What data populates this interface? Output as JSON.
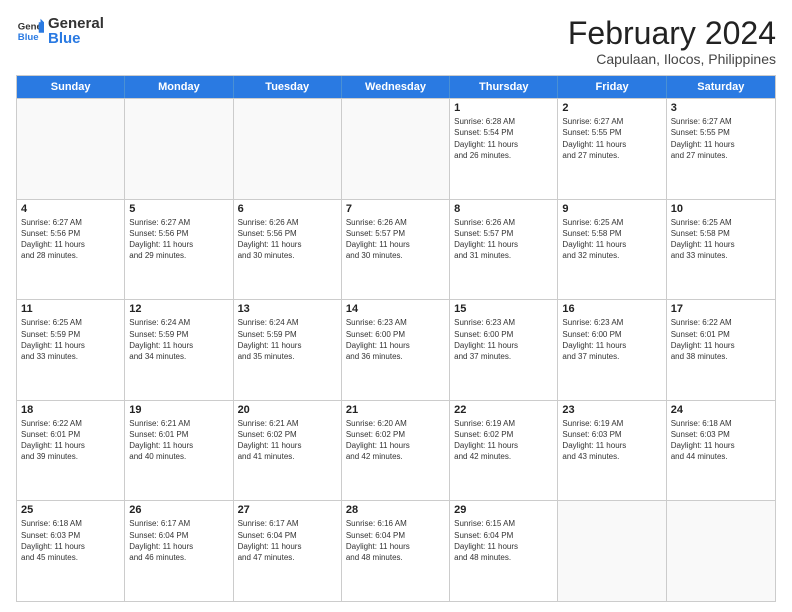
{
  "logo": {
    "general": "General",
    "blue": "Blue"
  },
  "title": "February 2024",
  "subtitle": "Capulaan, Ilocos, Philippines",
  "days": [
    "Sunday",
    "Monday",
    "Tuesday",
    "Wednesday",
    "Thursday",
    "Friday",
    "Saturday"
  ],
  "weeks": [
    [
      {
        "day": "",
        "empty": true
      },
      {
        "day": "",
        "empty": true
      },
      {
        "day": "",
        "empty": true
      },
      {
        "day": "",
        "empty": true
      },
      {
        "day": "1",
        "line1": "Sunrise: 6:28 AM",
        "line2": "Sunset: 5:54 PM",
        "line3": "Daylight: 11 hours",
        "line4": "and 26 minutes."
      },
      {
        "day": "2",
        "line1": "Sunrise: 6:27 AM",
        "line2": "Sunset: 5:55 PM",
        "line3": "Daylight: 11 hours",
        "line4": "and 27 minutes."
      },
      {
        "day": "3",
        "line1": "Sunrise: 6:27 AM",
        "line2": "Sunset: 5:55 PM",
        "line3": "Daylight: 11 hours",
        "line4": "and 27 minutes."
      }
    ],
    [
      {
        "day": "4",
        "line1": "Sunrise: 6:27 AM",
        "line2": "Sunset: 5:56 PM",
        "line3": "Daylight: 11 hours",
        "line4": "and 28 minutes."
      },
      {
        "day": "5",
        "line1": "Sunrise: 6:27 AM",
        "line2": "Sunset: 5:56 PM",
        "line3": "Daylight: 11 hours",
        "line4": "and 29 minutes."
      },
      {
        "day": "6",
        "line1": "Sunrise: 6:26 AM",
        "line2": "Sunset: 5:56 PM",
        "line3": "Daylight: 11 hours",
        "line4": "and 30 minutes."
      },
      {
        "day": "7",
        "line1": "Sunrise: 6:26 AM",
        "line2": "Sunset: 5:57 PM",
        "line3": "Daylight: 11 hours",
        "line4": "and 30 minutes."
      },
      {
        "day": "8",
        "line1": "Sunrise: 6:26 AM",
        "line2": "Sunset: 5:57 PM",
        "line3": "Daylight: 11 hours",
        "line4": "and 31 minutes."
      },
      {
        "day": "9",
        "line1": "Sunrise: 6:25 AM",
        "line2": "Sunset: 5:58 PM",
        "line3": "Daylight: 11 hours",
        "line4": "and 32 minutes."
      },
      {
        "day": "10",
        "line1": "Sunrise: 6:25 AM",
        "line2": "Sunset: 5:58 PM",
        "line3": "Daylight: 11 hours",
        "line4": "and 33 minutes."
      }
    ],
    [
      {
        "day": "11",
        "line1": "Sunrise: 6:25 AM",
        "line2": "Sunset: 5:59 PM",
        "line3": "Daylight: 11 hours",
        "line4": "and 33 minutes."
      },
      {
        "day": "12",
        "line1": "Sunrise: 6:24 AM",
        "line2": "Sunset: 5:59 PM",
        "line3": "Daylight: 11 hours",
        "line4": "and 34 minutes."
      },
      {
        "day": "13",
        "line1": "Sunrise: 6:24 AM",
        "line2": "Sunset: 5:59 PM",
        "line3": "Daylight: 11 hours",
        "line4": "and 35 minutes."
      },
      {
        "day": "14",
        "line1": "Sunrise: 6:23 AM",
        "line2": "Sunset: 6:00 PM",
        "line3": "Daylight: 11 hours",
        "line4": "and 36 minutes."
      },
      {
        "day": "15",
        "line1": "Sunrise: 6:23 AM",
        "line2": "Sunset: 6:00 PM",
        "line3": "Daylight: 11 hours",
        "line4": "and 37 minutes."
      },
      {
        "day": "16",
        "line1": "Sunrise: 6:23 AM",
        "line2": "Sunset: 6:00 PM",
        "line3": "Daylight: 11 hours",
        "line4": "and 37 minutes."
      },
      {
        "day": "17",
        "line1": "Sunrise: 6:22 AM",
        "line2": "Sunset: 6:01 PM",
        "line3": "Daylight: 11 hours",
        "line4": "and 38 minutes."
      }
    ],
    [
      {
        "day": "18",
        "line1": "Sunrise: 6:22 AM",
        "line2": "Sunset: 6:01 PM",
        "line3": "Daylight: 11 hours",
        "line4": "and 39 minutes."
      },
      {
        "day": "19",
        "line1": "Sunrise: 6:21 AM",
        "line2": "Sunset: 6:01 PM",
        "line3": "Daylight: 11 hours",
        "line4": "and 40 minutes."
      },
      {
        "day": "20",
        "line1": "Sunrise: 6:21 AM",
        "line2": "Sunset: 6:02 PM",
        "line3": "Daylight: 11 hours",
        "line4": "and 41 minutes."
      },
      {
        "day": "21",
        "line1": "Sunrise: 6:20 AM",
        "line2": "Sunset: 6:02 PM",
        "line3": "Daylight: 11 hours",
        "line4": "and 42 minutes."
      },
      {
        "day": "22",
        "line1": "Sunrise: 6:19 AM",
        "line2": "Sunset: 6:02 PM",
        "line3": "Daylight: 11 hours",
        "line4": "and 42 minutes."
      },
      {
        "day": "23",
        "line1": "Sunrise: 6:19 AM",
        "line2": "Sunset: 6:03 PM",
        "line3": "Daylight: 11 hours",
        "line4": "and 43 minutes."
      },
      {
        "day": "24",
        "line1": "Sunrise: 6:18 AM",
        "line2": "Sunset: 6:03 PM",
        "line3": "Daylight: 11 hours",
        "line4": "and 44 minutes."
      }
    ],
    [
      {
        "day": "25",
        "line1": "Sunrise: 6:18 AM",
        "line2": "Sunset: 6:03 PM",
        "line3": "Daylight: 11 hours",
        "line4": "and 45 minutes."
      },
      {
        "day": "26",
        "line1": "Sunrise: 6:17 AM",
        "line2": "Sunset: 6:04 PM",
        "line3": "Daylight: 11 hours",
        "line4": "and 46 minutes."
      },
      {
        "day": "27",
        "line1": "Sunrise: 6:17 AM",
        "line2": "Sunset: 6:04 PM",
        "line3": "Daylight: 11 hours",
        "line4": "and 47 minutes."
      },
      {
        "day": "28",
        "line1": "Sunrise: 6:16 AM",
        "line2": "Sunset: 6:04 PM",
        "line3": "Daylight: 11 hours",
        "line4": "and 48 minutes."
      },
      {
        "day": "29",
        "line1": "Sunrise: 6:15 AM",
        "line2": "Sunset: 6:04 PM",
        "line3": "Daylight: 11 hours",
        "line4": "and 48 minutes."
      },
      {
        "day": "",
        "empty": true
      },
      {
        "day": "",
        "empty": true
      }
    ]
  ]
}
